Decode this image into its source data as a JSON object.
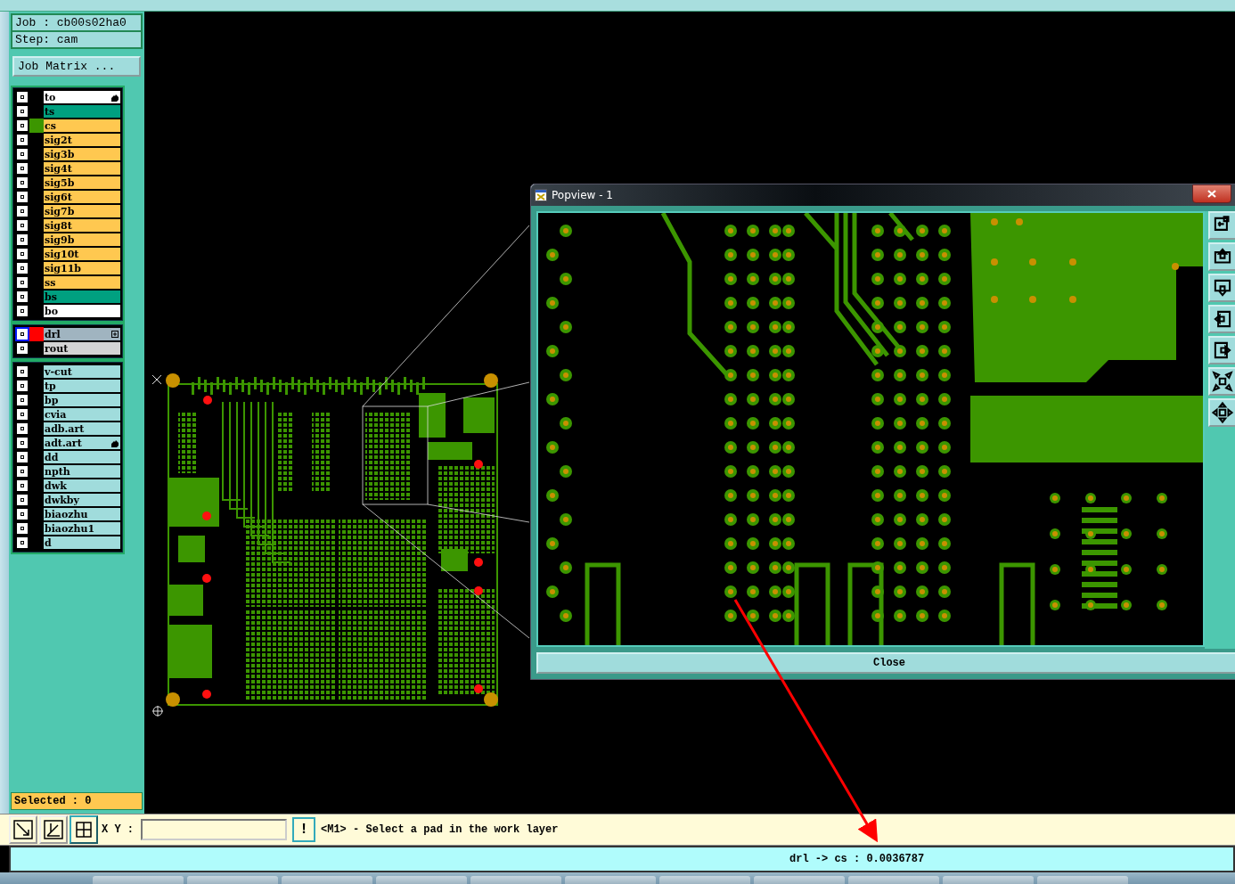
{
  "job": {
    "job_line": "Job : cb00s02ha0",
    "step_line": "Step: cam"
  },
  "job_matrix_button": "Job Matrix ...",
  "layer_groups": [
    {
      "layers": [
        {
          "name": "to",
          "color": "#ffffff",
          "work": false,
          "kind": "hand"
        },
        {
          "name": "ts",
          "color": "#00a080",
          "work": false,
          "kind": "plain"
        },
        {
          "name": "cs",
          "color": "#ffc850",
          "work": false,
          "kind": "plain",
          "display": {
            "color": "#3c9600"
          }
        },
        {
          "name": "sig2t",
          "color": "#ffc850",
          "work": false,
          "kind": "plain"
        },
        {
          "name": "sig3b",
          "color": "#ffc850",
          "work": false,
          "kind": "plain"
        },
        {
          "name": "sig4t",
          "color": "#ffc850",
          "work": false,
          "kind": "plain"
        },
        {
          "name": "sig5b",
          "color": "#ffc850",
          "work": false,
          "kind": "plain"
        },
        {
          "name": "sig6t",
          "color": "#ffc850",
          "work": false,
          "kind": "plain"
        },
        {
          "name": "sig7b",
          "color": "#ffc850",
          "work": false,
          "kind": "plain"
        },
        {
          "name": "sig8t",
          "color": "#ffc850",
          "work": false,
          "kind": "plain"
        },
        {
          "name": "sig9b",
          "color": "#ffc850",
          "work": false,
          "kind": "plain"
        },
        {
          "name": "sig10t",
          "color": "#ffc850",
          "work": false,
          "kind": "plain"
        },
        {
          "name": "sig11b",
          "color": "#ffc850",
          "work": false,
          "kind": "plain"
        },
        {
          "name": "ss",
          "color": "#ffc850",
          "work": false,
          "kind": "plain"
        },
        {
          "name": "bs",
          "color": "#00a080",
          "work": false,
          "kind": "plain"
        },
        {
          "name": "bo",
          "color": "#ffffff",
          "work": false,
          "kind": "plain"
        }
      ]
    },
    {
      "layers": [
        {
          "name": "drl",
          "color": "#a0b4c0",
          "work": true,
          "kind": "plus",
          "display": {
            "color": "#ff0000"
          }
        },
        {
          "name": "rout",
          "color": "#d4d4d4",
          "work": false,
          "kind": "plain"
        }
      ]
    },
    {
      "layers": [
        {
          "name": "v-cut",
          "color": "#a0dcdc",
          "work": false,
          "kind": "plain"
        },
        {
          "name": "tp",
          "color": "#a0dcdc",
          "work": false,
          "kind": "plain"
        },
        {
          "name": "bp",
          "color": "#a0dcdc",
          "work": false,
          "kind": "plain"
        },
        {
          "name": "cvia",
          "color": "#a0dcdc",
          "work": false,
          "kind": "plain"
        },
        {
          "name": "adb.art",
          "color": "#a0dcdc",
          "work": false,
          "kind": "plain"
        },
        {
          "name": "adt.art",
          "color": "#a0dcdc",
          "work": false,
          "kind": "hand"
        },
        {
          "name": "dd",
          "color": "#a0dcdc",
          "work": false,
          "kind": "plain"
        },
        {
          "name": "npth",
          "color": "#a0dcdc",
          "work": false,
          "kind": "plain"
        },
        {
          "name": "dwk",
          "color": "#a0dcdc",
          "work": false,
          "kind": "plain"
        },
        {
          "name": "dwkby",
          "color": "#a0dcdc",
          "work": false,
          "kind": "plain"
        },
        {
          "name": "biaozhu",
          "color": "#a0dcdc",
          "work": false,
          "kind": "plain"
        },
        {
          "name": "biaozhu1",
          "color": "#a0dcdc",
          "work": false,
          "kind": "plain"
        },
        {
          "name": "d",
          "color": "#a0dcdc",
          "work": false,
          "kind": "plain"
        }
      ]
    }
  ],
  "selected_count": "Selected : 0",
  "popview": {
    "title": "Popview - 1",
    "close_button": "Close"
  },
  "toolbar": {
    "xy_label": "X Y :",
    "action_key": "!",
    "message": "<M1> - Select a pad in the work layer"
  },
  "status_bar": {
    "text": "drl -> cs : 0.0036787"
  }
}
